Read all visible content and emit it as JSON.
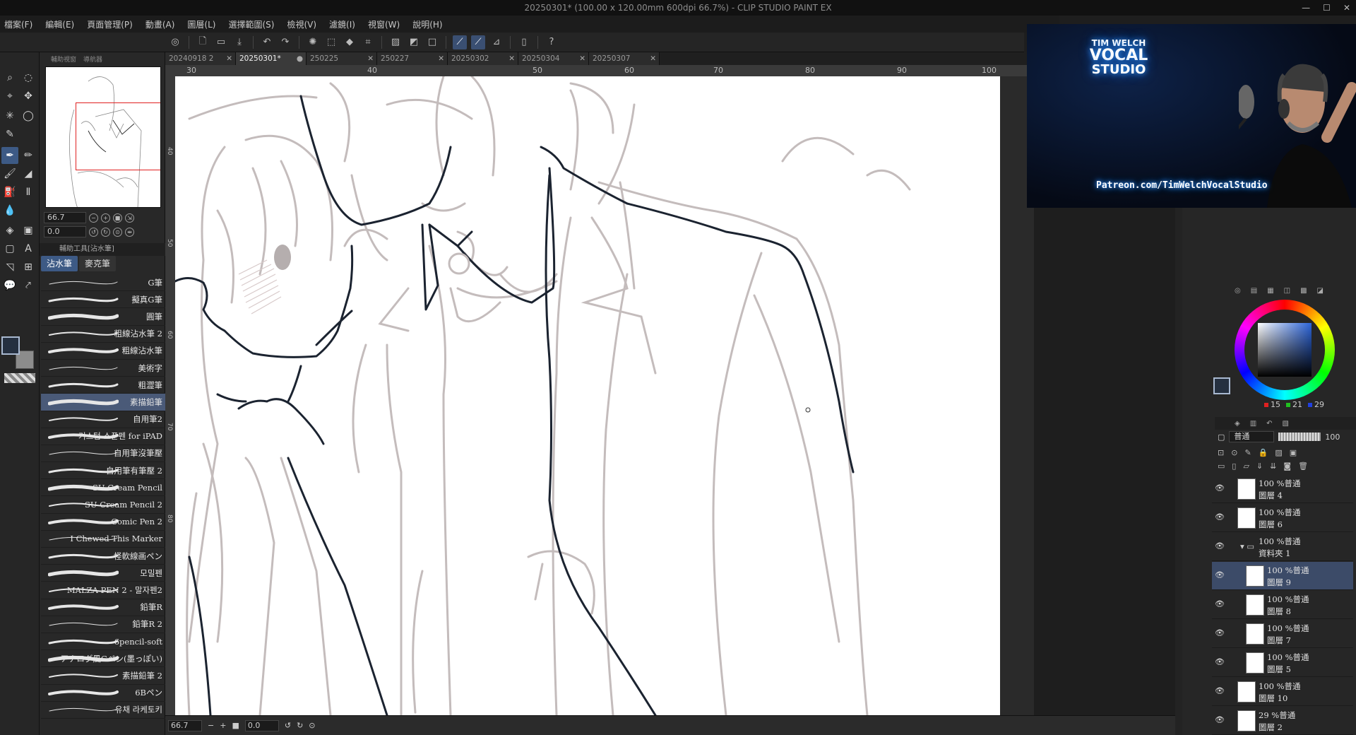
{
  "window": {
    "title": "20250301* (100.00 x 120.00mm 600dpi 66.7%) - CLIP STUDIO PAINT EX",
    "controls": [
      "—",
      "☐",
      "✕"
    ]
  },
  "menu": [
    "檔案(F)",
    "編輯(E)",
    "頁面管理(P)",
    "動畫(A)",
    "圖層(L)",
    "選擇範圍(S)",
    "檢視(V)",
    "濾鏡(I)",
    "視窗(W)",
    "說明(H)"
  ],
  "tabs": [
    {
      "label": "20240918 2",
      "close": "✕"
    },
    {
      "label": "20250301*",
      "close": "●"
    },
    {
      "label": "250225",
      "close": "✕"
    },
    {
      "label": "250227",
      "close": "✕"
    },
    {
      "label": "20250302",
      "close": "✕"
    },
    {
      "label": "20250304",
      "close": "✕"
    },
    {
      "label": "20250307",
      "close": "✕"
    }
  ],
  "ruler": {
    "top": [
      "30",
      "40",
      "50",
      "60",
      "70",
      "80",
      "90",
      "100"
    ],
    "left": [
      "40",
      "50",
      "60",
      "70",
      "80"
    ]
  },
  "navigator": {
    "tabs": [
      "輔助視窗",
      "導航器"
    ],
    "zoom": "66.7",
    "rotation": "0.0"
  },
  "subtool": {
    "title": "輔助工具[沾水筆]",
    "tabs": [
      "沾水筆",
      "麥克筆"
    ],
    "brushes": [
      "G筆",
      "擬真G筆",
      "圓筆",
      "粗線沾水筆 2",
      "粗線沾水筆",
      "美術字",
      "粗澀筆",
      "素描鉛筆",
      "自用筆2",
      "커스텀 스푼펜 for iPAD",
      "自用筆沒筆壓",
      "自用筆有筆壓 2",
      "SU Cream Pencil",
      "SU Cream Pencil 2",
      "Comic Pen 2",
      "I Chewed This Marker",
      "怪軟線画ペン",
      "모밀펜",
      "MALZA PEN 2 - 말자펜2",
      "鉛筆R",
      "鉛筆R 2",
      "6pencil-soft",
      "アナログ風Gペン(墨っぽい)",
      "素描鉛筆 2",
      "6Bペン",
      "유채 라케토키"
    ],
    "active_index": 7
  },
  "statusbar": {
    "zoom": "66.7",
    "rotation": "0.0"
  },
  "webcam": {
    "logo_line1": "TIM WELCH",
    "logo_line2": "VOCAL",
    "logo_line3": "STUDIO",
    "banner": "Patreon.com/TimWelchVocalStudio"
  },
  "color": {
    "r": "15",
    "g": "21",
    "b": "29",
    "main_hex": "#0f151d"
  },
  "layers_panel": {
    "blend_mode": "普通",
    "opacity": "100",
    "layers": [
      {
        "mode": "100 %普通",
        "name": "圖層 4",
        "indent": false,
        "active": false
      },
      {
        "mode": "100 %普通",
        "name": "圖層 6",
        "indent": false,
        "active": false
      },
      {
        "mode": "100 %普通",
        "name": "資料夾 1",
        "indent": false,
        "active": false,
        "folder": true
      },
      {
        "mode": "100 %普通",
        "name": "圖層 9",
        "indent": true,
        "active": true
      },
      {
        "mode": "100 %普通",
        "name": "圖層 8",
        "indent": true,
        "active": false
      },
      {
        "mode": "100 %普通",
        "name": "圖層 7",
        "indent": true,
        "active": false
      },
      {
        "mode": "100 %普通",
        "name": "圖層 5",
        "indent": true,
        "active": false
      },
      {
        "mode": "100 %普通",
        "name": "圖層 10",
        "indent": false,
        "active": false
      },
      {
        "mode": "29 %普通",
        "name": "圖層 2",
        "indent": false,
        "active": false
      }
    ]
  },
  "icons": {
    "tools": [
      "zoom-icon",
      "lasso-icon",
      "move-icon",
      "select-icon",
      "wand-icon",
      "eyedropper-icon",
      "pen-icon",
      "brush-icon",
      "eraser-icon",
      "fill-icon",
      "gradient-icon",
      "text-icon",
      "figure-icon",
      "ruler-icon",
      "balloon-icon",
      "operation-icon"
    ]
  }
}
